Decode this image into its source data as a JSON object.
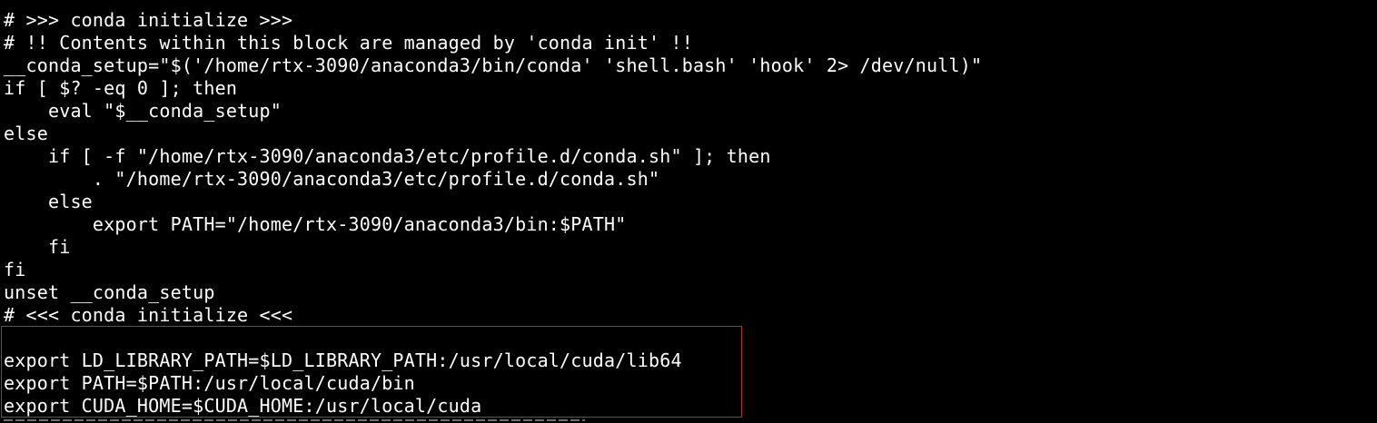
{
  "terminal": {
    "background": "#000000",
    "text_color": "#ffffff",
    "highlight_color": "#b03030",
    "lines": [
      "# >>> conda initialize >>>",
      "# !! Contents within this block are managed by 'conda init' !!",
      "__conda_setup=\"$('/home/rtx-3090/anaconda3/bin/conda' 'shell.bash' 'hook' 2> /dev/null)\"",
      "if [ $? -eq 0 ]; then",
      "    eval \"$__conda_setup\"",
      "else",
      "    if [ -f \"/home/rtx-3090/anaconda3/etc/profile.d/conda.sh\" ]; then",
      "        . \"/home/rtx-3090/anaconda3/etc/profile.d/conda.sh\"",
      "    else",
      "        export PATH=\"/home/rtx-3090/anaconda3/bin:$PATH\"",
      "    fi",
      "fi",
      "unset __conda_setup",
      "# <<< conda initialize <<<",
      "",
      "export LD_LIBRARY_PATH=$LD_LIBRARY_PATH:/usr/local/cuda/lib64",
      "export PATH=$PATH:/usr/local/cuda/bin",
      "export CUDA_HOME=$CUDA_HOME:/usr/local/cuda"
    ]
  }
}
